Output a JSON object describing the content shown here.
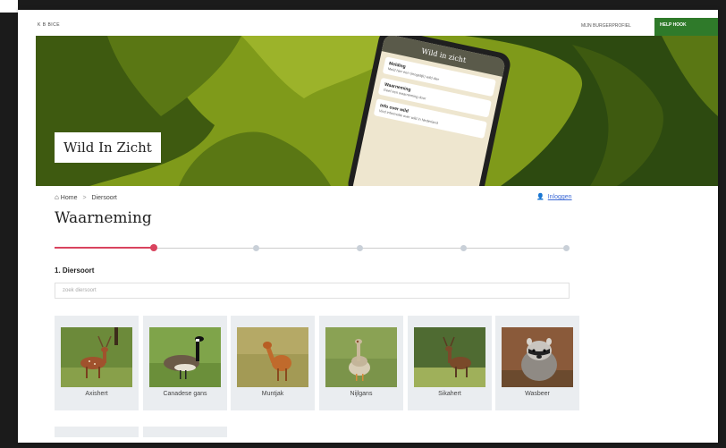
{
  "topbar": {
    "left_text": "K B BICE",
    "profile_label": "MIJN BURGERPROFIEL",
    "button_label": "HELP HOOK"
  },
  "hero": {
    "title": "Wild In Zicht",
    "phone": {
      "header": "Wild in zicht",
      "cards": [
        {
          "title": "Melding",
          "text": "Meld hier een (mogelijk) wild dier"
        },
        {
          "title": "Waarneming",
          "text": "Geef een waarneming door"
        },
        {
          "title": "Info over wild",
          "text": "Vind informatie over wild in Nederland"
        }
      ]
    }
  },
  "breadcrumb": {
    "home": "Home",
    "separator": ">",
    "current": "Diersoort"
  },
  "login_link": "Inloggen",
  "page_title": "Waarneming",
  "steps": {
    "total": 6,
    "current": 2
  },
  "section": {
    "label": "1. Diersoort",
    "search_placeholder": "zoek diersoort"
  },
  "animals": [
    {
      "name": "Axishert",
      "icon": "axis-deer-photo"
    },
    {
      "name": "Canadese gans",
      "icon": "canada-goose-photo"
    },
    {
      "name": "Muntjak",
      "icon": "muntjac-photo"
    },
    {
      "name": "Nijlgans",
      "icon": "egyptian-goose-photo"
    },
    {
      "name": "Sikahert",
      "icon": "sika-deer-photo"
    },
    {
      "name": "Wasbeer",
      "icon": "raccoon-photo"
    }
  ],
  "colors": {
    "accent": "#d9435e",
    "hero_green": "#7f9a1a",
    "dark_green": "#2d4a10",
    "link": "#3d6ad6"
  }
}
